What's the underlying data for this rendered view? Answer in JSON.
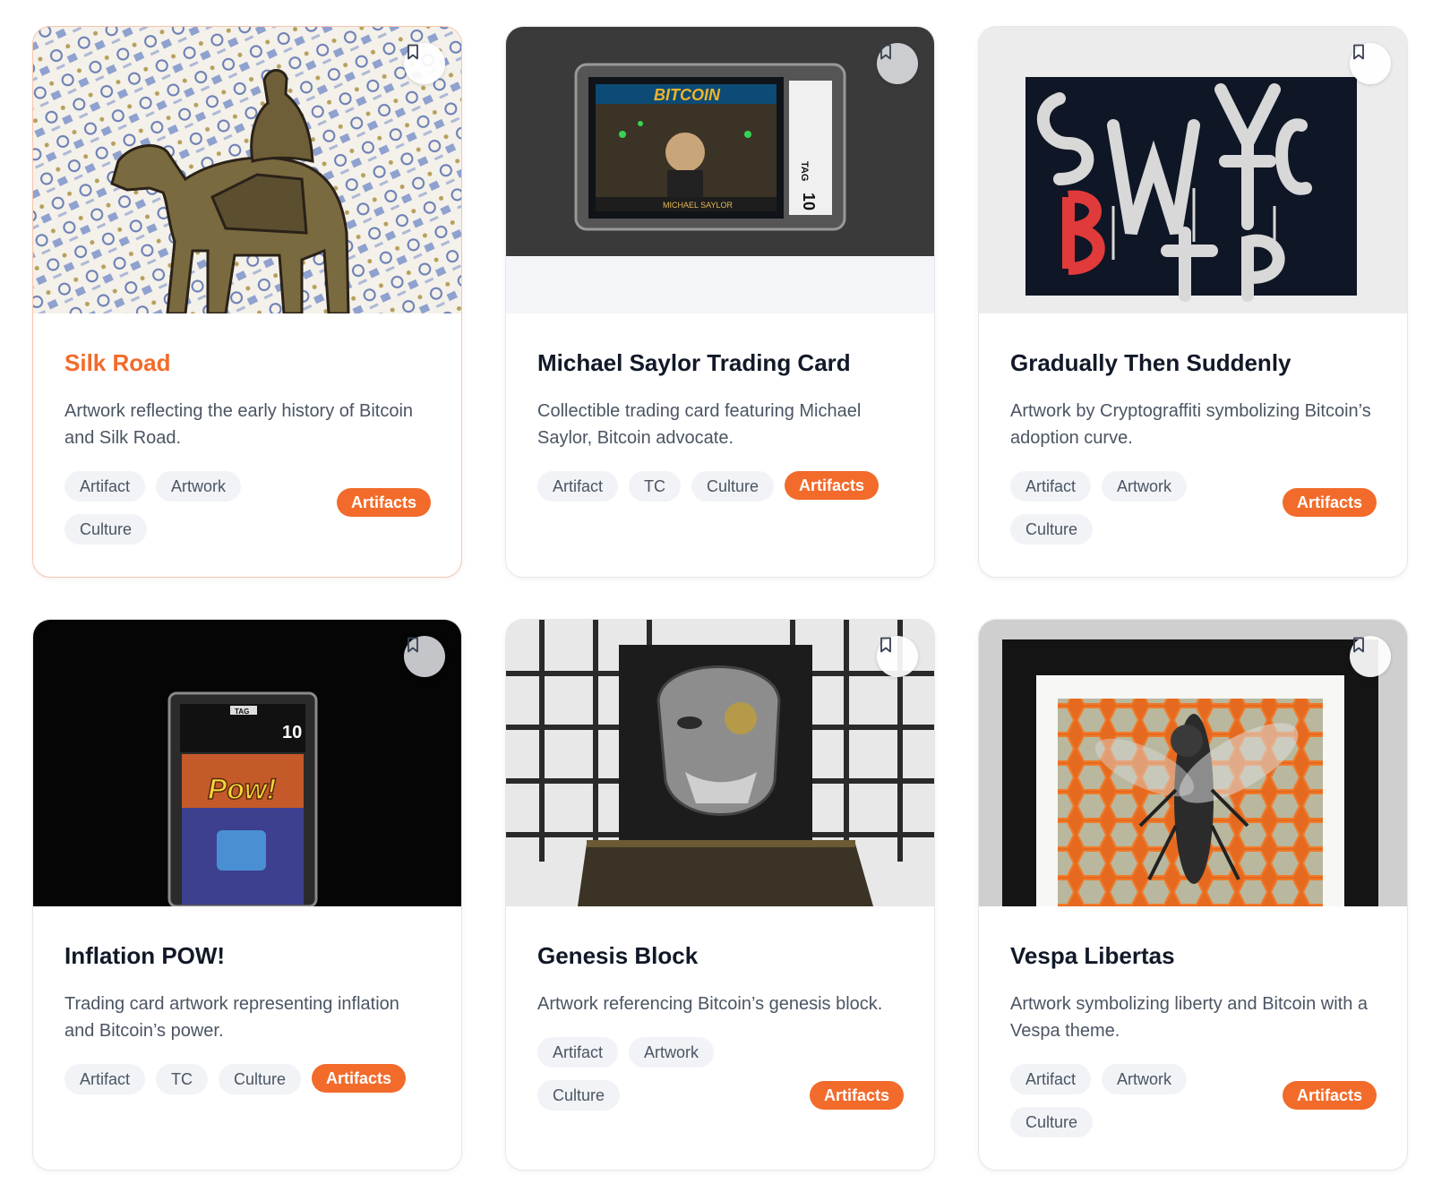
{
  "cards": [
    {
      "title": "Silk Road",
      "description": "Artwork reflecting the early history of Bitcoin and Silk Road.",
      "tags": [
        "Artifact",
        "Artwork",
        "Culture"
      ],
      "category": "Artifacts",
      "image_label": "camel-rider-artwork"
    },
    {
      "title": "Michael Saylor Trading Card",
      "description": "Collectible trading card featuring Michael Saylor, Bitcoin advocate.",
      "tags": [
        "Artifact",
        "TC",
        "Culture"
      ],
      "category": "Artifacts",
      "image_label": "graded-trading-card",
      "image_text": {
        "card_title": "BITCOIN",
        "card_name": "MICHAEL SAYLOR",
        "grade": "10",
        "brand": "TAG"
      }
    },
    {
      "title": "Gradually Then Suddenly",
      "description": "Artwork by Cryptograffiti symbolizing Bitcoin’s adoption curve.",
      "tags": [
        "Artifact",
        "Artwork",
        "Culture"
      ],
      "category": "Artifacts",
      "image_label": "currency-symbol-graffiti"
    },
    {
      "title": "Inflation POW!",
      "description": "Trading card artwork representing inflation and Bitcoin’s power.",
      "tags": [
        "Artifact",
        "TC",
        "Culture"
      ],
      "category": "Artifacts",
      "image_label": "graded-pow-card",
      "image_text": {
        "brand": "TAG",
        "grade": "10",
        "card_word": "Pow!"
      }
    },
    {
      "title": "Genesis Block",
      "description": "Artwork referencing Bitcoin’s genesis block.",
      "tags": [
        "Artifact",
        "Artwork",
        "Culture"
      ],
      "category": "Artifacts",
      "image_label": "masked-face-sculpture"
    },
    {
      "title": "Vespa Libertas",
      "description": "Artwork symbolizing liberty and Bitcoin with a Vespa theme.",
      "tags": [
        "Artifact",
        "Artwork",
        "Culture"
      ],
      "category": "Artifacts",
      "image_label": "framed-wasp-artwork"
    }
  ],
  "icons": {
    "bookmark": "bookmark-icon"
  },
  "colors": {
    "accent": "#f26b2b",
    "tag_bg": "#f1f3f6",
    "title": "#111827",
    "desc": "#4b5563"
  }
}
